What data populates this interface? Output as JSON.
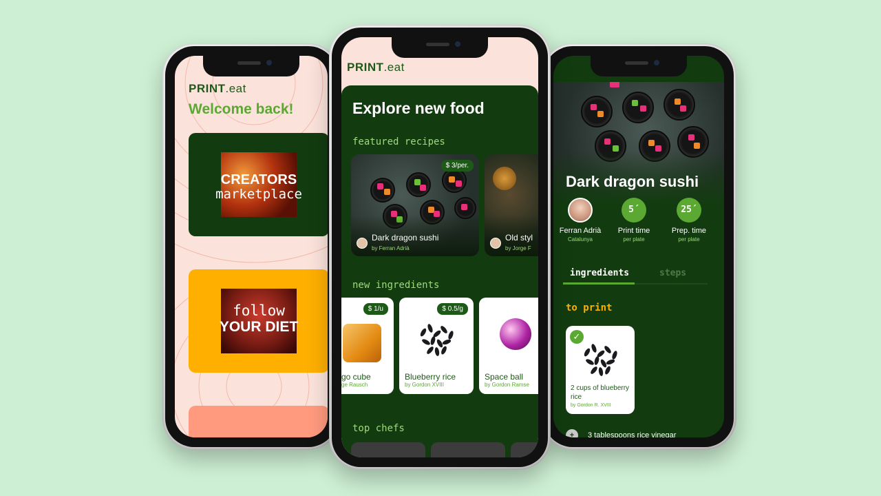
{
  "brand": {
    "logo_bold": "PRINT",
    "logo_light": ".eat"
  },
  "left_screen": {
    "greeting": "Welcome back!",
    "promo_creators": {
      "line1": "CREATORS",
      "line2": "marketplace"
    },
    "promo_diet": {
      "line1": "follow",
      "line2": "YOUR DIET"
    }
  },
  "center_screen": {
    "title": "Explore new food",
    "featured_heading": "featured recipes",
    "recipes": [
      {
        "name": "Dark dragon sushi",
        "author": "by Ferran Adrià",
        "price": "$ 3/per."
      },
      {
        "name": "Old styl",
        "author": "by Jorge F"
      }
    ],
    "ingredients_heading": "new ingredients",
    "ingredients": [
      {
        "name": "go cube",
        "author": "ge Rausch",
        "price": "$ 1/u"
      },
      {
        "name": "Blueberry rice",
        "author": "by Gordon XVIII",
        "price": "$ 0.5/g"
      },
      {
        "name": "Space ball",
        "author": "by Gordon Ramse"
      }
    ],
    "chefs_heading": "top chefs"
  },
  "right_screen": {
    "dish_title": "Dark dragon sushi",
    "chef": {
      "name": "Ferran Adrià",
      "region": "Catalunya"
    },
    "print_time": {
      "value": "5´",
      "label": "Print time",
      "sub": "per plate"
    },
    "prep_time": {
      "value": "25´",
      "label": "Prep. time",
      "sub": "per plate"
    },
    "tabs": [
      "ingredients",
      "steps"
    ],
    "to_print_heading": "to print",
    "print_item": {
      "name": "2 cups of blueberry rice",
      "author": "by Gordon R. XVIII"
    },
    "next_ingredient": "3 tablespoons rice vinegar"
  },
  "colors": {
    "background": "#cdefd3",
    "dark_green": "#123c0f",
    "accent_green": "#5ba932",
    "orange": "#ffaf00",
    "salmon": "#ff9a7e",
    "pink": "#fbe3dc"
  }
}
